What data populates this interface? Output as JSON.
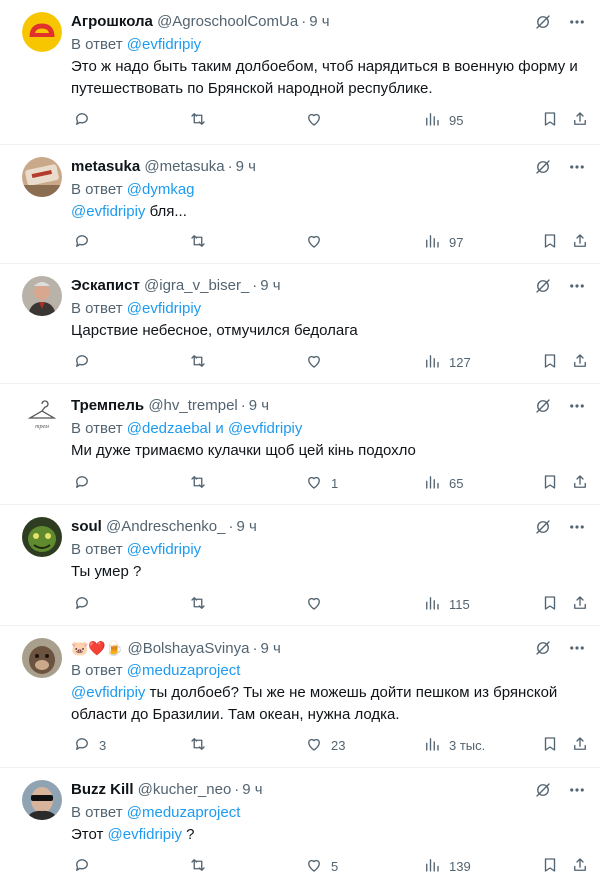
{
  "reply_prefix": "В ответ",
  "tweets": [
    {
      "name": "Агрошкола",
      "handle": "@AgroschoolComUa",
      "time": "9 ч",
      "reply_to": [
        "@evfidripiy"
      ],
      "text_mention": "",
      "text": "Это ж надо быть таким долбоебом, чтоб нарядиться в военную форму и путешествовать по Брянской народной республике.",
      "replies": "",
      "retweets": "",
      "likes": "",
      "views": "95"
    },
    {
      "name": "metasuka",
      "handle": "@metasuka",
      "time": "9 ч",
      "reply_to": [
        "@dymkag"
      ],
      "text_mention": "@evfidripiy",
      "text": " бля...",
      "replies": "",
      "retweets": "",
      "likes": "",
      "views": "97"
    },
    {
      "name": "Эскапист",
      "handle": "@igra_v_biser_",
      "time": "9 ч",
      "reply_to": [
        "@evfidripiy"
      ],
      "text_mention": "",
      "text": "Царствие небесное, отмучился бедолага",
      "replies": "",
      "retweets": "",
      "likes": "",
      "views": "127"
    },
    {
      "name": "Трempель",
      "handle": "@hv_trempel",
      "time": "9 ч",
      "reply_to": [
        "@dedzaebal",
        "@evfidripiy"
      ],
      "reply_joiner": "и",
      "text_mention": "",
      "text": "Ми дуже тримаємо кулачки щоб цей кінь подохло",
      "replies": "",
      "retweets": "",
      "likes": "1",
      "views": "65"
    },
    {
      "name": "soul",
      "handle": "@Andreschenko_",
      "time": "9 ч",
      "reply_to": [
        "@evfidripiy"
      ],
      "text_mention": "",
      "text": "Ты умер ?",
      "replies": "",
      "retweets": "",
      "likes": "",
      "views": "115"
    },
    {
      "name": "🐷❤️🍺",
      "handle": "@BolshayaSvinya",
      "time": "9 ч",
      "reply_to": [
        "@meduzaproject"
      ],
      "text_mention": "@evfidripiy",
      "text": " ты долбоеб? Ты же не можешь дойти пешком из брянской области до Бразилии. Там океан, нужна лодка.",
      "replies": "3",
      "retweets": "",
      "likes": "23",
      "views": "3 тыс."
    },
    {
      "name": "Buzz Kill",
      "handle": "@kucher_neo",
      "time": "9 ч",
      "reply_to": [
        "@meduzaproject"
      ],
      "text_prefix": "Этот ",
      "text_mention": "@evfidripiy",
      "text": " ?",
      "replies": "",
      "retweets": "",
      "likes": "5",
      "views": "139"
    }
  ],
  "icons": {
    "grok": "grok-slash-icon",
    "more": "more-dots-icon",
    "reply": "reply-bubble-icon",
    "retweet": "retweet-icon",
    "like": "heart-icon",
    "views": "views-bars-icon",
    "bookmark": "bookmark-icon",
    "share": "share-icon"
  },
  "colors": {
    "link": "#1d9bf0",
    "muted": "#536471",
    "text": "#0f1419",
    "divider": "#eff3f4"
  }
}
